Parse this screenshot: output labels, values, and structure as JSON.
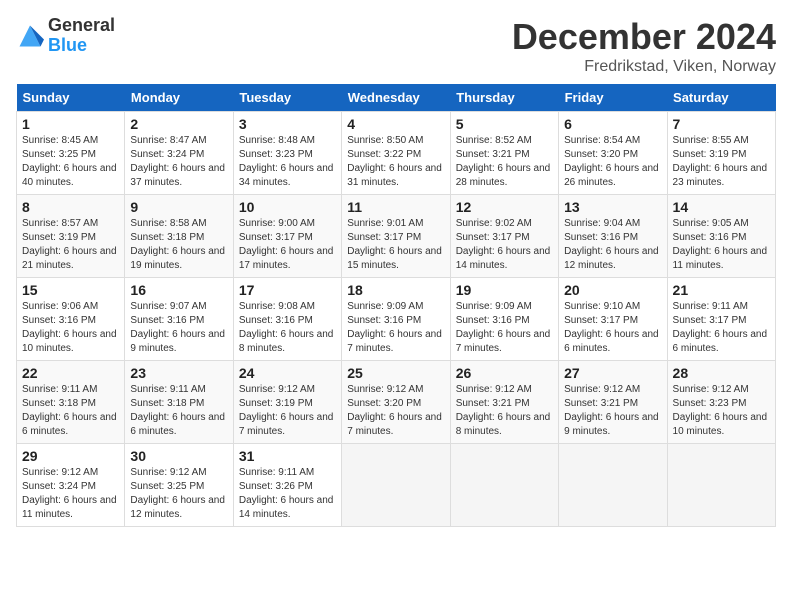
{
  "header": {
    "logo_general": "General",
    "logo_blue": "Blue",
    "month_title": "December 2024",
    "location": "Fredrikstad, Viken, Norway"
  },
  "weekdays": [
    "Sunday",
    "Monday",
    "Tuesday",
    "Wednesday",
    "Thursday",
    "Friday",
    "Saturday"
  ],
  "weeks": [
    [
      {
        "day": "1",
        "sunrise": "Sunrise: 8:45 AM",
        "sunset": "Sunset: 3:25 PM",
        "daylight": "Daylight: 6 hours and 40 minutes."
      },
      {
        "day": "2",
        "sunrise": "Sunrise: 8:47 AM",
        "sunset": "Sunset: 3:24 PM",
        "daylight": "Daylight: 6 hours and 37 minutes."
      },
      {
        "day": "3",
        "sunrise": "Sunrise: 8:48 AM",
        "sunset": "Sunset: 3:23 PM",
        "daylight": "Daylight: 6 hours and 34 minutes."
      },
      {
        "day": "4",
        "sunrise": "Sunrise: 8:50 AM",
        "sunset": "Sunset: 3:22 PM",
        "daylight": "Daylight: 6 hours and 31 minutes."
      },
      {
        "day": "5",
        "sunrise": "Sunrise: 8:52 AM",
        "sunset": "Sunset: 3:21 PM",
        "daylight": "Daylight: 6 hours and 28 minutes."
      },
      {
        "day": "6",
        "sunrise": "Sunrise: 8:54 AM",
        "sunset": "Sunset: 3:20 PM",
        "daylight": "Daylight: 6 hours and 26 minutes."
      },
      {
        "day": "7",
        "sunrise": "Sunrise: 8:55 AM",
        "sunset": "Sunset: 3:19 PM",
        "daylight": "Daylight: 6 hours and 23 minutes."
      }
    ],
    [
      {
        "day": "8",
        "sunrise": "Sunrise: 8:57 AM",
        "sunset": "Sunset: 3:19 PM",
        "daylight": "Daylight: 6 hours and 21 minutes."
      },
      {
        "day": "9",
        "sunrise": "Sunrise: 8:58 AM",
        "sunset": "Sunset: 3:18 PM",
        "daylight": "Daylight: 6 hours and 19 minutes."
      },
      {
        "day": "10",
        "sunrise": "Sunrise: 9:00 AM",
        "sunset": "Sunset: 3:17 PM",
        "daylight": "Daylight: 6 hours and 17 minutes."
      },
      {
        "day": "11",
        "sunrise": "Sunrise: 9:01 AM",
        "sunset": "Sunset: 3:17 PM",
        "daylight": "Daylight: 6 hours and 15 minutes."
      },
      {
        "day": "12",
        "sunrise": "Sunrise: 9:02 AM",
        "sunset": "Sunset: 3:17 PM",
        "daylight": "Daylight: 6 hours and 14 minutes."
      },
      {
        "day": "13",
        "sunrise": "Sunrise: 9:04 AM",
        "sunset": "Sunset: 3:16 PM",
        "daylight": "Daylight: 6 hours and 12 minutes."
      },
      {
        "day": "14",
        "sunrise": "Sunrise: 9:05 AM",
        "sunset": "Sunset: 3:16 PM",
        "daylight": "Daylight: 6 hours and 11 minutes."
      }
    ],
    [
      {
        "day": "15",
        "sunrise": "Sunrise: 9:06 AM",
        "sunset": "Sunset: 3:16 PM",
        "daylight": "Daylight: 6 hours and 10 minutes."
      },
      {
        "day": "16",
        "sunrise": "Sunrise: 9:07 AM",
        "sunset": "Sunset: 3:16 PM",
        "daylight": "Daylight: 6 hours and 9 minutes."
      },
      {
        "day": "17",
        "sunrise": "Sunrise: 9:08 AM",
        "sunset": "Sunset: 3:16 PM",
        "daylight": "Daylight: 6 hours and 8 minutes."
      },
      {
        "day": "18",
        "sunrise": "Sunrise: 9:09 AM",
        "sunset": "Sunset: 3:16 PM",
        "daylight": "Daylight: 6 hours and 7 minutes."
      },
      {
        "day": "19",
        "sunrise": "Sunrise: 9:09 AM",
        "sunset": "Sunset: 3:16 PM",
        "daylight": "Daylight: 6 hours and 7 minutes."
      },
      {
        "day": "20",
        "sunrise": "Sunrise: 9:10 AM",
        "sunset": "Sunset: 3:17 PM",
        "daylight": "Daylight: 6 hours and 6 minutes."
      },
      {
        "day": "21",
        "sunrise": "Sunrise: 9:11 AM",
        "sunset": "Sunset: 3:17 PM",
        "daylight": "Daylight: 6 hours and 6 minutes."
      }
    ],
    [
      {
        "day": "22",
        "sunrise": "Sunrise: 9:11 AM",
        "sunset": "Sunset: 3:18 PM",
        "daylight": "Daylight: 6 hours and 6 minutes."
      },
      {
        "day": "23",
        "sunrise": "Sunrise: 9:11 AM",
        "sunset": "Sunset: 3:18 PM",
        "daylight": "Daylight: 6 hours and 6 minutes."
      },
      {
        "day": "24",
        "sunrise": "Sunrise: 9:12 AM",
        "sunset": "Sunset: 3:19 PM",
        "daylight": "Daylight: 6 hours and 7 minutes."
      },
      {
        "day": "25",
        "sunrise": "Sunrise: 9:12 AM",
        "sunset": "Sunset: 3:20 PM",
        "daylight": "Daylight: 6 hours and 7 minutes."
      },
      {
        "day": "26",
        "sunrise": "Sunrise: 9:12 AM",
        "sunset": "Sunset: 3:21 PM",
        "daylight": "Daylight: 6 hours and 8 minutes."
      },
      {
        "day": "27",
        "sunrise": "Sunrise: 9:12 AM",
        "sunset": "Sunset: 3:21 PM",
        "daylight": "Daylight: 6 hours and 9 minutes."
      },
      {
        "day": "28",
        "sunrise": "Sunrise: 9:12 AM",
        "sunset": "Sunset: 3:23 PM",
        "daylight": "Daylight: 6 hours and 10 minutes."
      }
    ],
    [
      {
        "day": "29",
        "sunrise": "Sunrise: 9:12 AM",
        "sunset": "Sunset: 3:24 PM",
        "daylight": "Daylight: 6 hours and 11 minutes."
      },
      {
        "day": "30",
        "sunrise": "Sunrise: 9:12 AM",
        "sunset": "Sunset: 3:25 PM",
        "daylight": "Daylight: 6 hours and 12 minutes."
      },
      {
        "day": "31",
        "sunrise": "Sunrise: 9:11 AM",
        "sunset": "Sunset: 3:26 PM",
        "daylight": "Daylight: 6 hours and 14 minutes."
      },
      null,
      null,
      null,
      null
    ]
  ]
}
